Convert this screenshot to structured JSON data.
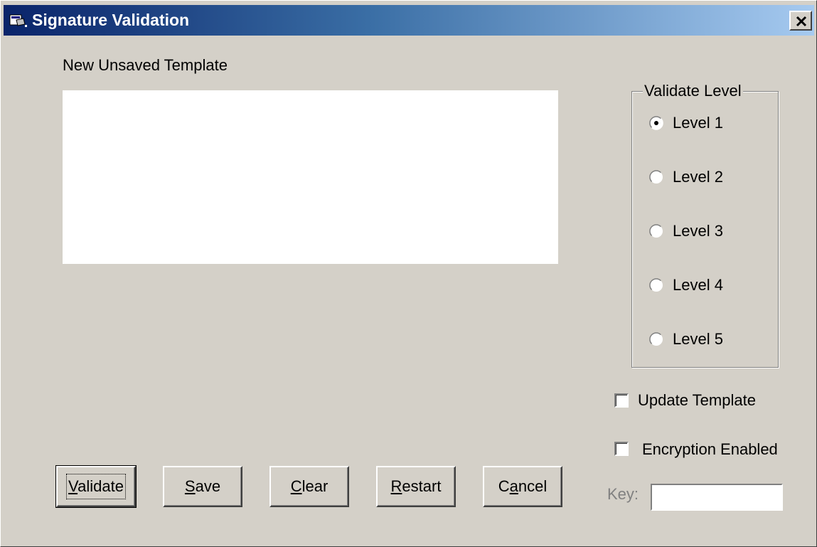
{
  "window": {
    "title": "Signature Validation"
  },
  "template": {
    "name_label": "New Unsaved Template"
  },
  "validate_level": {
    "legend": "Validate Level",
    "options": [
      {
        "label": "Level 1",
        "selected": true
      },
      {
        "label": "Level 2",
        "selected": false
      },
      {
        "label": "Level 3",
        "selected": false
      },
      {
        "label": "Level 4",
        "selected": false
      },
      {
        "label": "Level 5",
        "selected": false
      }
    ]
  },
  "options": {
    "update_template": {
      "label": "Update Template",
      "checked": false
    },
    "encryption_enabled": {
      "label": "Encryption Enabled",
      "checked": false
    }
  },
  "buttons": {
    "validate": {
      "prefix": "",
      "accel": "V",
      "rest": "alidate"
    },
    "save": {
      "prefix": "",
      "accel": "S",
      "rest": "ave"
    },
    "clear": {
      "prefix": "",
      "accel": "C",
      "rest": "lear"
    },
    "restart": {
      "prefix": "",
      "accel": "R",
      "rest": "estart"
    },
    "cancel": {
      "prefix": "C",
      "accel": "a",
      "rest": "ncel"
    }
  },
  "key": {
    "label": "Key:",
    "value": ""
  },
  "colors": {
    "face": "#d4d0c8",
    "title_start": "#0a246a",
    "title_end": "#a6caf0"
  }
}
